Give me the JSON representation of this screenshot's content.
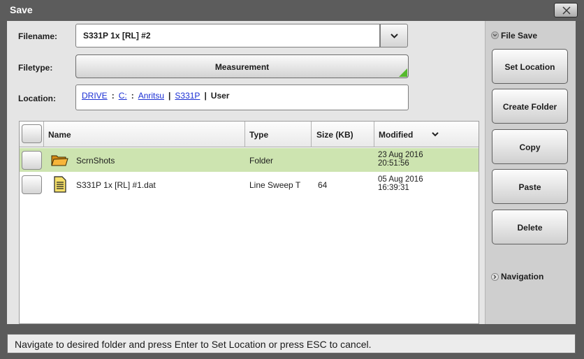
{
  "window": {
    "title": "Save"
  },
  "form": {
    "filename_label": "Filename:",
    "filename_value": "S331P 1x [RL] #2",
    "filetype_label": "Filetype:",
    "filetype_value": "Measurement",
    "location_label": "Location:",
    "location_crumbs": [
      "DRIVE",
      "C:",
      "Anritsu",
      "S331P"
    ],
    "location_separators": [
      ":",
      ":",
      "|",
      "|"
    ],
    "location_current": "User"
  },
  "table": {
    "headers": {
      "name": "Name",
      "type": "Type",
      "size": "Size (KB)",
      "modified": "Modified"
    },
    "rows": [
      {
        "name": "ScrnShots",
        "type": "Folder",
        "size": "",
        "modified_date": "23 Aug 2016",
        "modified_time": "20:51:56",
        "icon": "folder-icon",
        "selected": true
      },
      {
        "name": "S331P 1x [RL] #1.dat",
        "type": "Line Sweep T",
        "size": "64",
        "modified_date": "05 Aug 2016",
        "modified_time": "16:39:31",
        "icon": "document-icon",
        "selected": false
      }
    ]
  },
  "sidebar": {
    "file_save_label": "File Save",
    "buttons": [
      "Set Location",
      "Create Folder",
      "Copy",
      "Paste",
      "Delete"
    ],
    "navigation_label": "Navigation"
  },
  "status": {
    "text": "Navigate to desired folder and press Enter to Set Location or press ESC to cancel."
  },
  "colors": {
    "selected_row": "#cde4b0",
    "link": "#1a2ed4",
    "accent_corner": "#55b92c"
  }
}
